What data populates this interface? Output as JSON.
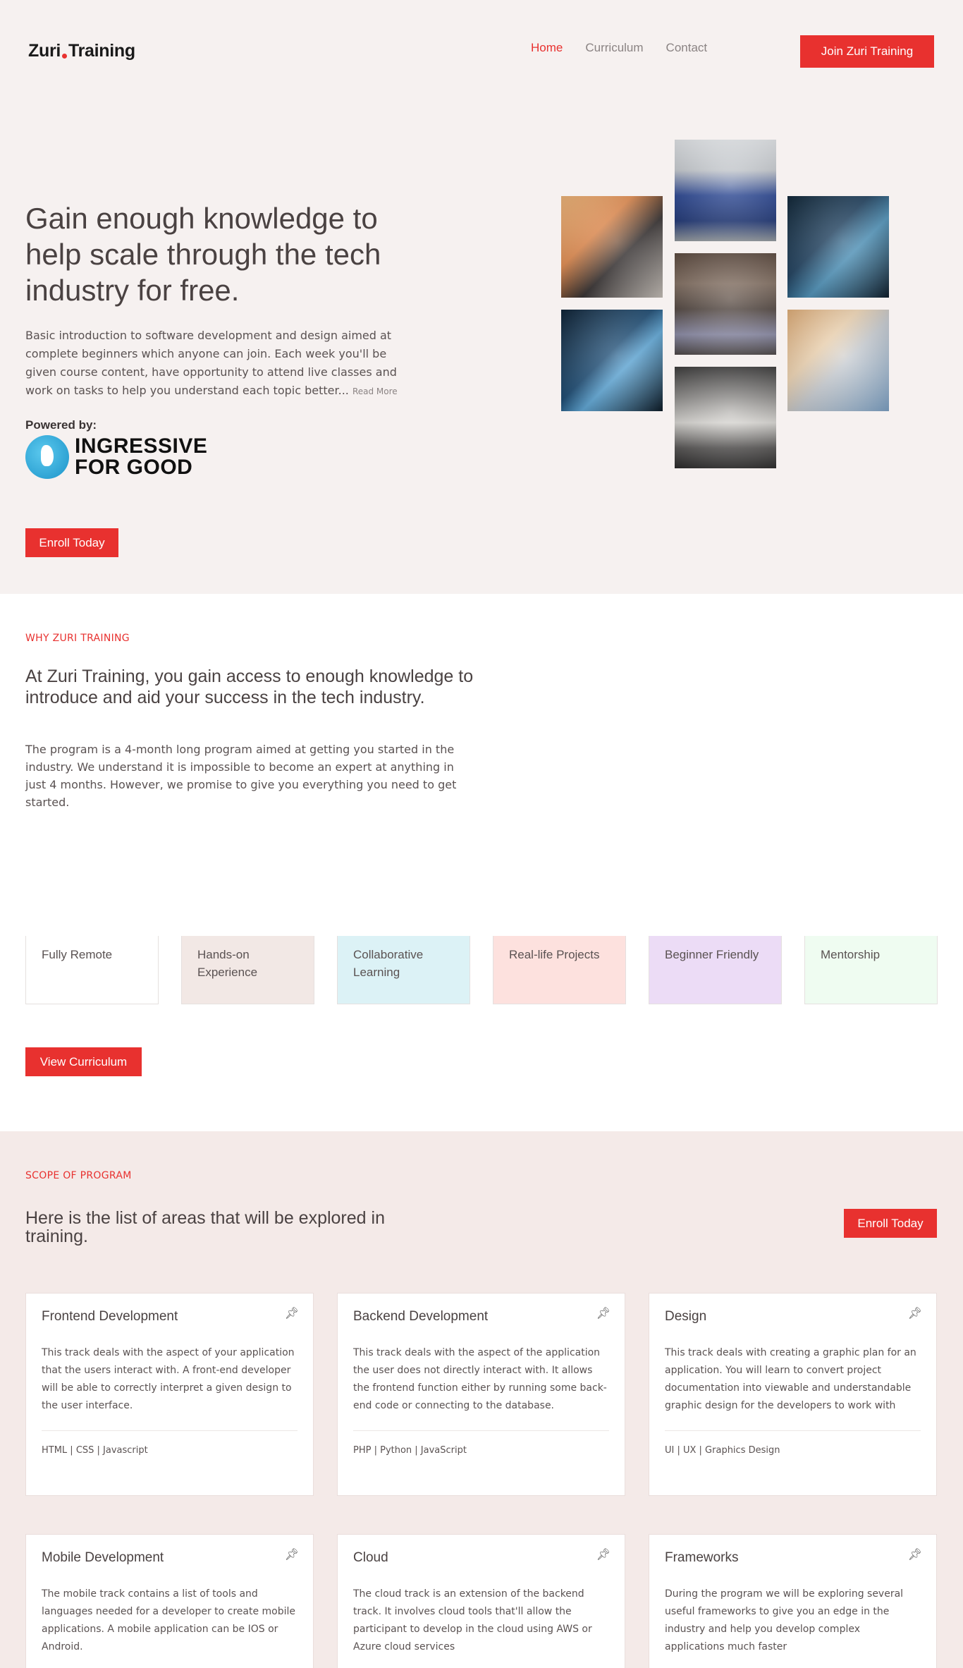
{
  "header": {
    "logo_left": "Zuri",
    "logo_right": "Training",
    "nav": [
      {
        "label": "Home",
        "active": true
      },
      {
        "label": "Curriculum",
        "active": false
      },
      {
        "label": "Contact",
        "active": false
      }
    ],
    "cta_label": "Join Zuri Training"
  },
  "hero": {
    "title": "Gain enough knowledge to help scale through the tech industry for free.",
    "description": "Basic introduction to software development and design aimed at complete beginners which anyone can join. Each week you'll be given course content, have opportunity to attend live classes and work on tasks to help you understand each topic better...",
    "read_more": "Read More",
    "powered_by": "Powered by:",
    "partner_line1": "INGRESSIVE",
    "partner_line2": "FOR GOOD",
    "enroll_label": "Enroll Today"
  },
  "why": {
    "label": "WHY ZURI TRAINING",
    "title": "At Zuri Training, you gain access to enough knowledge to introduce and aid your success in the tech industry.",
    "description": "The program is a 4-month long program aimed at getting you started in the industry. We understand it is impossible to become an expert at anything in just 4 months. However, we promise to give you everything you need to get started.",
    "features": [
      "Fully Remote",
      "Hands-on Experience",
      "Collaborative Learning",
      "Real-life Projects",
      "Beginner Friendly",
      "Mentorship"
    ],
    "view_label": "View Curriculum"
  },
  "scope": {
    "label": "SCOPE OF PROGRAM",
    "title": "Here is the list of areas that will be explored in training.",
    "enroll_label": "Enroll Today",
    "cards": [
      {
        "title": "Frontend Development",
        "desc": "This track deals with the aspect of your application that the users interact with. A front-end developer will be able to correctly interpret a given design to the user interface.",
        "tags": "HTML | CSS | Javascript"
      },
      {
        "title": "Backend Development",
        "desc": "This track deals with the aspect of the application the user does not directly interact with. It allows the frontend function either by running some back-end code or connecting to the database.",
        "tags": "PHP | Python | JavaScript"
      },
      {
        "title": "Design",
        "desc": "This track deals with creating a graphic plan for an application. You will learn to convert project documentation into viewable and understandable graphic design for the developers to work with",
        "tags": "UI | UX | Graphics Design"
      },
      {
        "title": "Mobile Development",
        "desc": "The mobile track contains a list of tools and languages needed for a developer to create mobile applications. A mobile application can be IOS or Android."
      },
      {
        "title": "Cloud",
        "desc": "The cloud track is an extension of the backend track. It involves cloud tools that'll allow the participant to develop in the cloud using AWS or Azure cloud services"
      },
      {
        "title": "Frameworks",
        "desc": "During the program we will be exploring several useful frameworks to give you an edge in the industry and help you develop complex applications much faster"
      }
    ]
  },
  "colors": {
    "accent": "#e8312f",
    "hero_bg": "#f6f1f0",
    "scope_bg": "#f4eae8"
  },
  "icons": {
    "card_icon": "pin-icon",
    "partner_logo": "globe-icon"
  }
}
